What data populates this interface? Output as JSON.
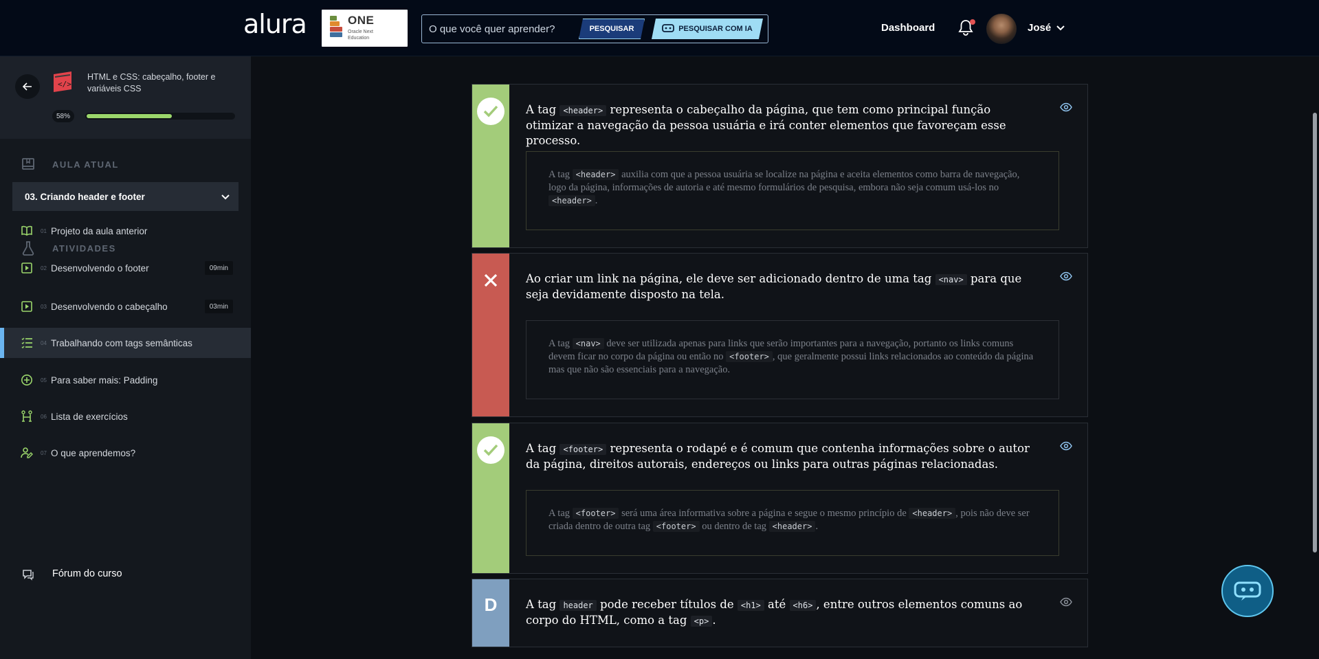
{
  "header": {
    "logo_text": "alura",
    "partner_title": "ONE",
    "partner_subtitle": "Oracle Next Education",
    "search_placeholder": "O que você quer aprender?",
    "search_button": "PESQUISAR",
    "search_ai_button": "PESQUISAR COM IA",
    "nav_dashboard": "Dashboard",
    "user_name": "José"
  },
  "sidebar": {
    "course_title": "HTML e CSS: cabeçalho, footer e variáveis CSS",
    "progress_label": "58%",
    "progress_value": 0.58,
    "current_lesson_label": "AULA ATUAL",
    "current_lesson": "03. Criando header e footer",
    "activities_label": "ATIVIDADES",
    "activities": [
      {
        "num": "01",
        "label": "Projeto da aula anterior",
        "duration": "",
        "icon": "book-icon",
        "active": false
      },
      {
        "num": "02",
        "label": "Desenvolvendo o footer",
        "duration": "09min",
        "icon": "video-icon",
        "active": false
      },
      {
        "num": "03",
        "label": "Desenvolvendo o cabeçalho",
        "duration": "03min",
        "icon": "video-icon",
        "active": false
      },
      {
        "num": "04",
        "label": "Trabalhando com tags semânticas",
        "duration": "",
        "icon": "list-icon",
        "active": true
      },
      {
        "num": "05",
        "label": "Para saber mais: Padding",
        "duration": "",
        "icon": "plus-circle-icon",
        "active": false
      },
      {
        "num": "06",
        "label": "Lista de exercícios",
        "duration": "",
        "icon": "exercise-icon",
        "active": false
      },
      {
        "num": "07",
        "label": "O que aprendemos?",
        "duration": "",
        "icon": "learned-icon",
        "active": false
      }
    ],
    "forum_label": "Fórum do curso"
  },
  "colors": {
    "correct": "#a3cc7a",
    "wrong": "#c85a52",
    "neutral": "#7f9fbf",
    "accent": "#6bb5f0",
    "progress": "#9bd66b"
  },
  "cards": [
    {
      "status": "correct",
      "question": [
        "A tag ",
        {
          "code": "<header>"
        },
        " representa o cabeçalho da página, que tem como principal função otimizar a navegação da pessoa usuária e irá conter elementos que favoreçam esse processo."
      ],
      "explanation": [
        "A tag ",
        {
          "code": "<header>"
        },
        " auxilia com que a pessoa usuária se localize na página e aceita elementos como barra de navegação, logo da página, informações de autoria e até mesmo formulários de pesquisa, embora não seja comum usá-los no ",
        {
          "code": "<header>"
        },
        "."
      ]
    },
    {
      "status": "wrong",
      "question": [
        "Ao criar um link na página, ele deve ser adicionado dentro de uma tag ",
        {
          "code": "<nav>"
        },
        " para que seja devidamente disposto na tela."
      ],
      "explanation": [
        "A tag ",
        {
          "code": "<nav>"
        },
        " deve ser utilizada apenas para links que serão importantes para a navegação, portanto os links comuns devem ficar no corpo da página ou então no ",
        {
          "code": "<footer>"
        },
        ", que geralmente possui links relacionados ao conteúdo da página mas que não são essenciais para a navegação."
      ]
    },
    {
      "status": "correct",
      "question": [
        "A tag ",
        {
          "code": "<footer>"
        },
        " representa o rodapé e é comum que contenha informações sobre o autor da página, direitos autorais, endereços ou links para outras páginas relacionadas."
      ],
      "explanation": [
        "A tag ",
        {
          "code": "<footer>"
        },
        " será uma área informativa sobre a página e segue o mesmo princípio de ",
        {
          "code": "<header>"
        },
        ", pois não deve ser criada dentro de outra tag ",
        {
          "code": "<footer>"
        },
        " ou dentro de tag ",
        {
          "code": "<header>"
        },
        "."
      ]
    },
    {
      "status": "neutral",
      "letter": "D",
      "question": [
        "A tag ",
        {
          "code": "header"
        },
        " pode receber títulos de ",
        {
          "code": "<h1>"
        },
        " até ",
        {
          "code": "<h6>"
        },
        ", entre outros elementos comuns ao corpo do HTML, como a tag ",
        {
          "code": "<p>"
        },
        "."
      ],
      "explanation": []
    }
  ]
}
